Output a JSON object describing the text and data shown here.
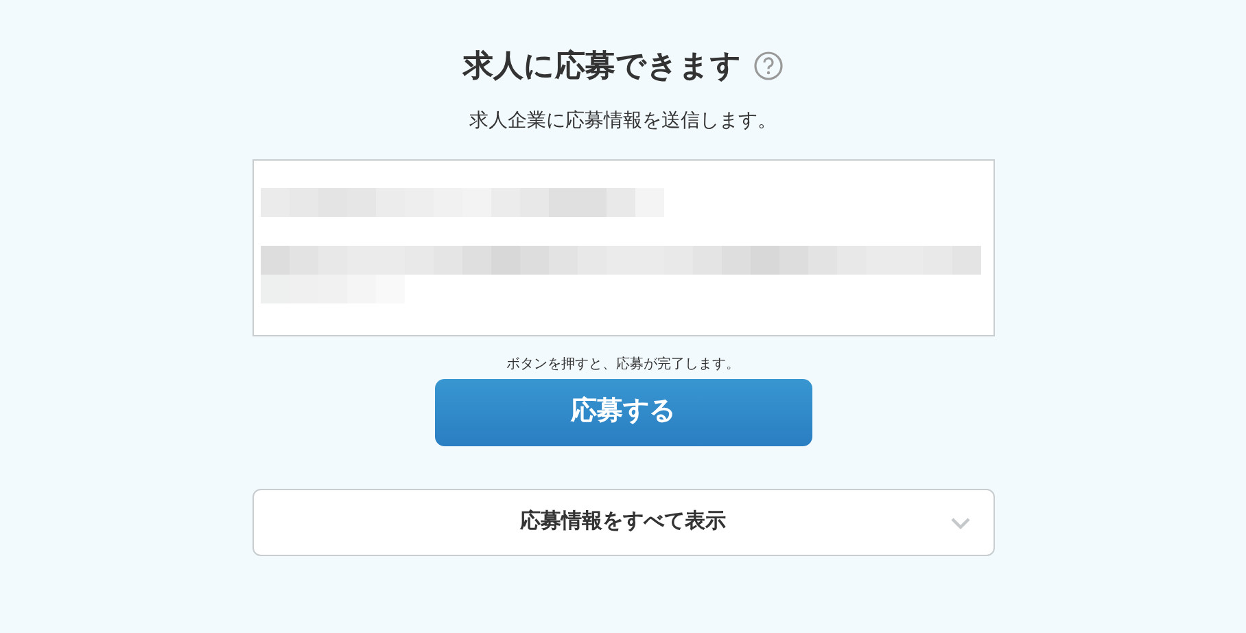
{
  "title": "求人に応募できます",
  "subtitle": "求人企業に応募情報を送信します。",
  "note": "ボタンを押すと、応募が完了します。",
  "submit_button": "応募する",
  "details_toggle": {
    "label": "応募情報をすべて表示",
    "expanded": false
  }
}
